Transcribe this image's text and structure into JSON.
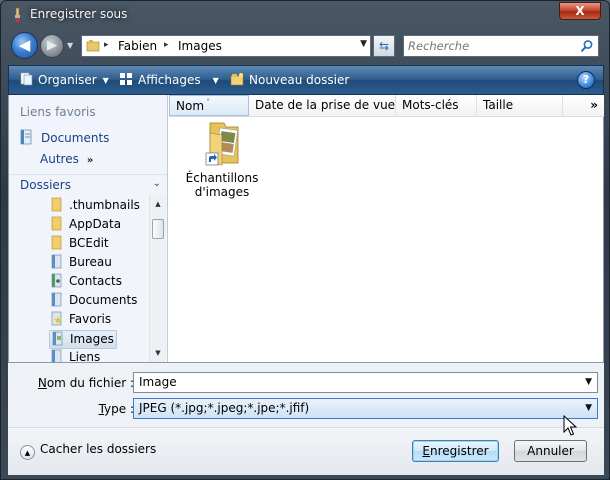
{
  "window": {
    "title": "Enregistrer sous",
    "close_glyph": "X"
  },
  "nav": {
    "back_glyph": "◀",
    "forward_glyph": "▶",
    "history_glyph": "▼"
  },
  "address": {
    "crumbs": [
      "Fabien",
      "Images"
    ],
    "separator": "▸",
    "dropdown_glyph": "▼",
    "refresh_glyph": "⇆"
  },
  "search": {
    "placeholder": "Recherche"
  },
  "toolbar": {
    "organize": "Organiser",
    "views": "Affichages",
    "new_folder": "Nouveau dossier",
    "caret": "▼",
    "help": "?"
  },
  "sidebar": {
    "favorites_header": "Liens favoris",
    "favorites": [
      {
        "label": "Documents",
        "icon": "documents-icon"
      }
    ],
    "more_label": "Autres",
    "more_glyph": "»",
    "folders_header": "Dossiers",
    "folders_glyph": "⌄",
    "tree": [
      {
        "label": ".thumbnails",
        "icon": "folder-icon"
      },
      {
        "label": "AppData",
        "icon": "folder-icon"
      },
      {
        "label": "BCEdit",
        "icon": "folder-icon"
      },
      {
        "label": "Bureau",
        "icon": "desktop-icon"
      },
      {
        "label": "Contacts",
        "icon": "contacts-icon"
      },
      {
        "label": "Documents",
        "icon": "documents-icon"
      },
      {
        "label": "Favoris",
        "icon": "favorites-icon"
      },
      {
        "label": "Images",
        "icon": "pictures-icon",
        "selected": true
      },
      {
        "label": "Liens",
        "icon": "links-icon"
      }
    ]
  },
  "columns": [
    "Nom",
    "Date de la prise de vue",
    "Mots-clés",
    "Taille"
  ],
  "columns_more": "»",
  "sort_glyph": "˄",
  "files": [
    {
      "name_line1": "Échantillons",
      "name_line2": "d'images",
      "icon": "picture-folder-shortcut-icon"
    }
  ],
  "form": {
    "filename_label": "Nom du fichier :",
    "filename_value": "Image",
    "type_label": "Type :",
    "type_value": "JPEG (*.jpg;*.jpeg;*.jpe;*.jfif)",
    "drop_glyph": "▼"
  },
  "footer": {
    "hide_folders": "Cacher les dossiers",
    "hide_glyph": "▲",
    "save": "Enregistrer",
    "cancel": "Annuler"
  },
  "colors": {
    "command_bar": "#2f5d8c",
    "nav_pane": "#f1f5fb",
    "link_text": "#1a3f88",
    "accent": "#3c7fb1"
  }
}
